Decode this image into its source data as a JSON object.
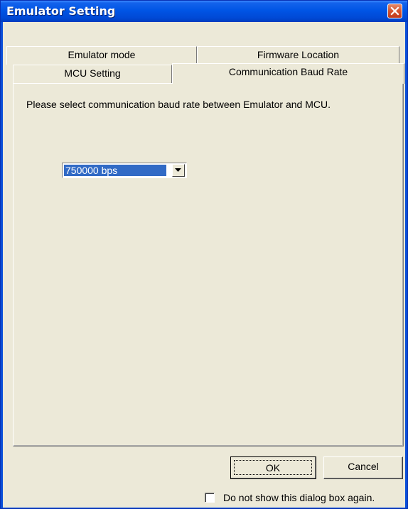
{
  "window": {
    "title": "Emulator Setting"
  },
  "tabs": {
    "row1": [
      "Emulator mode",
      "Firmware Location"
    ],
    "row2": [
      "MCU Setting",
      "Communication Baud Rate"
    ],
    "active": "Communication Baud Rate"
  },
  "panel": {
    "instruction": "Please select communication baud rate between Emulator and MCU.",
    "baud_rate": {
      "selected": "750000 bps"
    }
  },
  "buttons": {
    "ok": "OK",
    "cancel": "Cancel"
  },
  "footer": {
    "checkbox_label": "Do not show this dialog box again.",
    "checked": false
  },
  "colors": {
    "titlebar": "#0055e5",
    "face": "#ece9d8",
    "selection": "#316ac5",
    "close": "#d4532d"
  }
}
